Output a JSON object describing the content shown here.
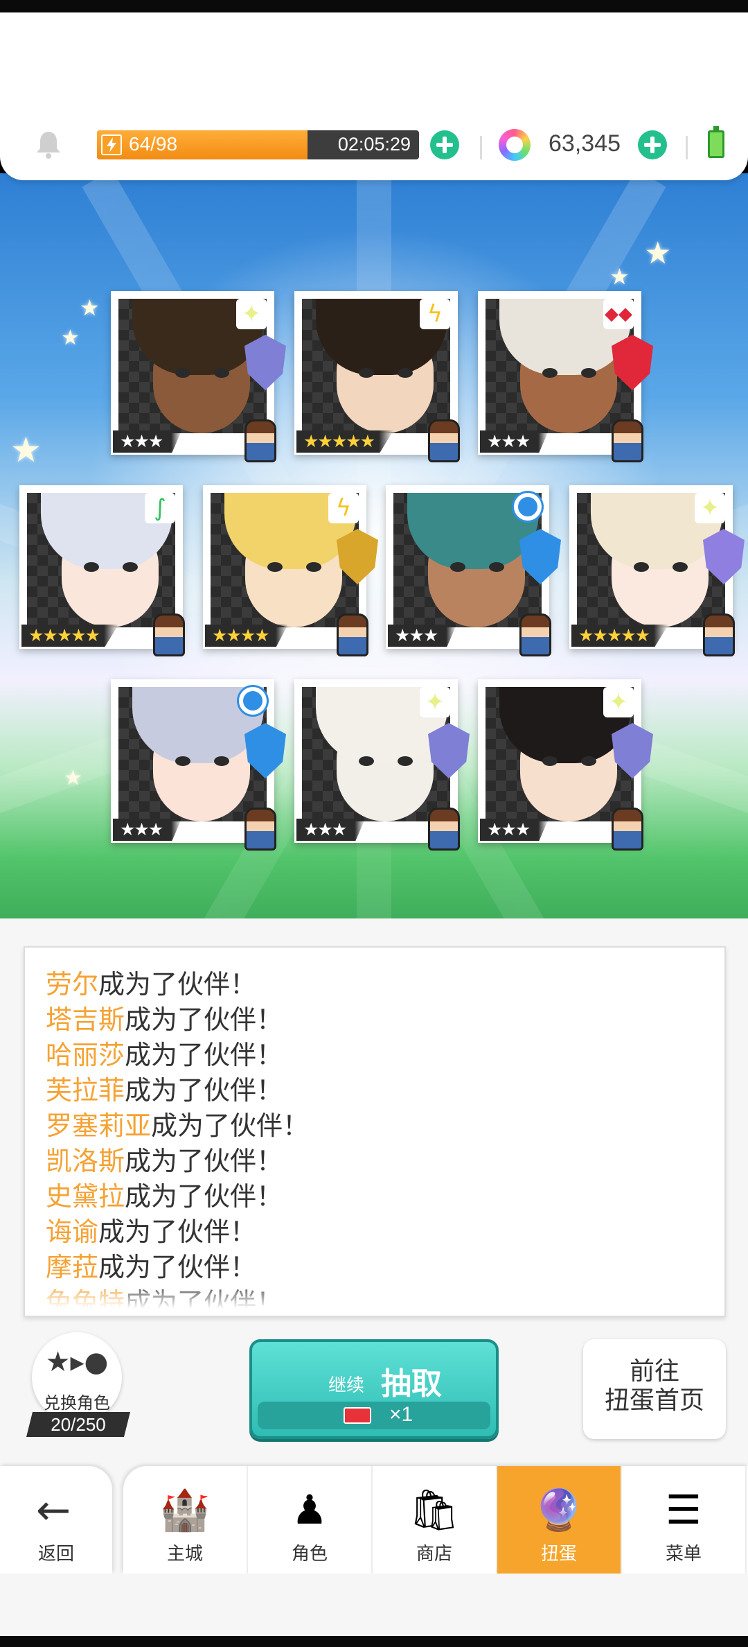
{
  "header": {
    "stamina": {
      "current_max": "64/98",
      "fraction": 0.653,
      "timer": "02:05:29"
    },
    "gems": "63,345",
    "icons": [
      "bell-icon",
      "lightning-icon",
      "plus-icon",
      "rainbow-gem-icon",
      "plus-icon",
      "battery-icon"
    ],
    "colors": {
      "stamina_fill": "#f28c12",
      "plus": "#23c08d",
      "battery": "#7fdc5a"
    }
  },
  "gacha": {
    "cards": [
      {
        "element": "light",
        "rarity": "★★★",
        "hair": "#3a2a1c",
        "skin": "#8a5a3a",
        "weapon": "shield"
      },
      {
        "element": "thunder",
        "rarity": "★★★★★",
        "hair": "#2b2017",
        "skin": "#f3d6be",
        "weapon": "none"
      },
      {
        "element": "fire",
        "rarity": "★★★",
        "hair": "#e8e4dc",
        "skin": "#a56a45",
        "weapon": "flame"
      },
      {
        "element": "wind",
        "rarity": "★★★★★",
        "hair": "#dfe3ef",
        "skin": "#fbe6dc",
        "weapon": "none"
      },
      {
        "element": "thunder",
        "rarity": "★★★★",
        "hair": "#f2d36a",
        "skin": "#f7e0c4",
        "weapon": "gold-shield"
      },
      {
        "element": "water",
        "rarity": "★★★",
        "hair": "#3a8a8a",
        "skin": "#b9835f",
        "weapon": "water-drop"
      },
      {
        "element": "light",
        "rarity": "★★★★★",
        "hair": "#f1e6cf",
        "skin": "#fbe9df",
        "weapon": "star-shield"
      },
      {
        "element": "water",
        "rarity": "★★★",
        "hair": "#c7cbe0",
        "skin": "#fbe3d7",
        "weapon": "water-drop"
      },
      {
        "element": "light",
        "rarity": "★★★",
        "hair": "#f3f0ea",
        "skin": "#f2eee8",
        "weapon": "shield"
      },
      {
        "element": "light",
        "rarity": "★★★",
        "hair": "#1f1a1a",
        "skin": "#f7dfcd",
        "weapon": "shield"
      }
    ]
  },
  "log": {
    "lines": [
      {
        "name": "劳尔",
        "text": "成为了伙伴！"
      },
      {
        "name": "塔吉斯",
        "text": "成为了伙伴！"
      },
      {
        "name": "哈丽莎",
        "text": "成为了伙伴！"
      },
      {
        "name": "芙拉菲",
        "text": "成为了伙伴！"
      },
      {
        "name": "罗塞莉亚",
        "text": "成为了伙伴！"
      },
      {
        "name": "凯洛斯",
        "text": "成为了伙伴！"
      },
      {
        "name": "史黛拉",
        "text": "成为了伙伴！"
      },
      {
        "name": "诲谕",
        "text": "成为了伙伴！"
      },
      {
        "name": "摩菈",
        "text": "成为了伙伴！"
      },
      {
        "name": "兔兔特",
        "text": "成为了伙伴！"
      }
    ]
  },
  "actions": {
    "exchange_label": "兑换角色",
    "exchange_count": "20/250",
    "pull_small": "继续",
    "pull_big": "抽取",
    "pull_cost": "×1",
    "goto_line1": "前往",
    "goto_line2": "扭蛋首页"
  },
  "tabbar": {
    "back": "返回",
    "tabs": [
      {
        "label": "主城",
        "icon": "castle-icon",
        "glyph": "🏰"
      },
      {
        "label": "角色",
        "icon": "character-icon",
        "glyph": "♟"
      },
      {
        "label": "商店",
        "icon": "shop-bag-icon",
        "glyph": "🛍"
      },
      {
        "label": "扭蛋",
        "icon": "gacha-orb-icon",
        "glyph": "🔮"
      },
      {
        "label": "菜单",
        "icon": "menu-list-icon",
        "glyph": "☰"
      }
    ],
    "active_tab": "扭蛋",
    "colors": {
      "active": "#f7a42c"
    }
  }
}
